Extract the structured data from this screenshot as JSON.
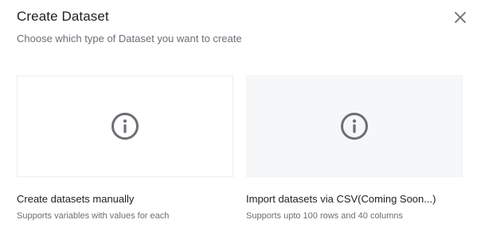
{
  "dialog": {
    "title": "Create Dataset",
    "subtitle": "Choose which type of Dataset you want to create",
    "close_icon": "close-icon"
  },
  "options": [
    {
      "title": "Create datasets manually",
      "description": "Supports variables with values for each",
      "icon": "info-icon"
    },
    {
      "title": "Import datasets via CSV(Coming Soon...)",
      "description": "Supports upto 100 rows and 40 columns",
      "icon": "info-icon"
    }
  ],
  "colors": {
    "icon": "#6b6e73",
    "card_disabled_bg": "#f6f7f9"
  }
}
